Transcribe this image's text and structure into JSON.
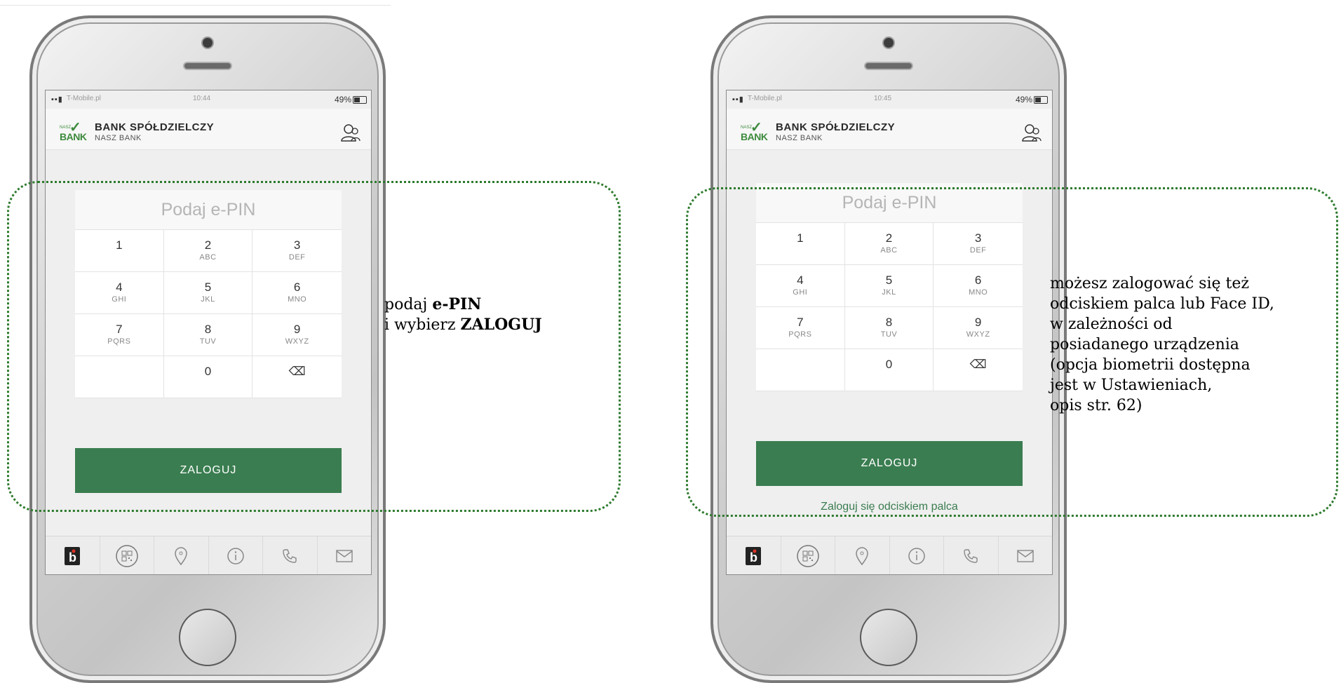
{
  "left_phone": {
    "status_bar": {
      "carrier": "T-Mobile.pl",
      "time": "10:44",
      "battery": "49%"
    },
    "header": {
      "logo_small": "NASZ",
      "logo_big": "BANK",
      "title": "BANK SPÓŁDZIELCZY",
      "subtitle": "NASZ BANK"
    },
    "pin_placeholder": "Podaj e-PIN",
    "keys": [
      {
        "num": "1",
        "letters": ""
      },
      {
        "num": "2",
        "letters": "ABC"
      },
      {
        "num": "3",
        "letters": "DEF"
      },
      {
        "num": "4",
        "letters": "GHI"
      },
      {
        "num": "5",
        "letters": "JKL"
      },
      {
        "num": "6",
        "letters": "MNO"
      },
      {
        "num": "7",
        "letters": "PQRS"
      },
      {
        "num": "8",
        "letters": "TUV"
      },
      {
        "num": "9",
        "letters": "WXYZ"
      },
      {
        "num": "",
        "letters": ""
      },
      {
        "num": "0",
        "letters": ""
      },
      {
        "num": "⌫",
        "letters": ""
      }
    ],
    "login_button": "ZALOGUJ",
    "tabbar_icons": [
      "bs-logo-icon",
      "qr-code-icon",
      "location-pin-icon",
      "info-icon",
      "phone-icon",
      "mail-icon"
    ]
  },
  "right_phone": {
    "status_bar": {
      "carrier": "T-Mobile.pl",
      "time": "10:45",
      "battery": "49%"
    },
    "header": {
      "logo_small": "NASZ",
      "logo_big": "BANK",
      "title": "BANK SPÓŁDZIELCZY",
      "subtitle": "NASZ BANK"
    },
    "pin_placeholder": "Podaj e-PIN",
    "keys": [
      {
        "num": "1",
        "letters": ""
      },
      {
        "num": "2",
        "letters": "ABC"
      },
      {
        "num": "3",
        "letters": "DEF"
      },
      {
        "num": "4",
        "letters": "GHI"
      },
      {
        "num": "5",
        "letters": "JKL"
      },
      {
        "num": "6",
        "letters": "MNO"
      },
      {
        "num": "7",
        "letters": "PQRS"
      },
      {
        "num": "8",
        "letters": "TUV"
      },
      {
        "num": "9",
        "letters": "WXYZ"
      },
      {
        "num": "",
        "letters": ""
      },
      {
        "num": "0",
        "letters": ""
      },
      {
        "num": "⌫",
        "letters": ""
      }
    ],
    "login_button": "ZALOGUJ",
    "fingerprint_link": "Zaloguj się odciskiem palca",
    "tabbar_icons": [
      "bs-logo-icon",
      "qr-code-icon",
      "location-pin-icon",
      "info-icon",
      "phone-icon",
      "mail-icon"
    ]
  },
  "captions": {
    "left": {
      "line1_pre": "podaj ",
      "line1_bold": "e-PIN",
      "line2_pre": "i wybierz ",
      "line2_bold": "ZALOGUJ"
    },
    "right": [
      "możesz zalogować się też",
      "odciskiem palca lub Face ID,",
      "w zależności od",
      "posiadanego urządzenia",
      "(opcja biometrii dostępna",
      "jest w Ustawieniach,",
      "opis str. 62)"
    ]
  },
  "colors": {
    "brand_green": "#3a7d50",
    "highlight_border": "#2d7a2d",
    "logo_green": "#3d8a3d"
  }
}
